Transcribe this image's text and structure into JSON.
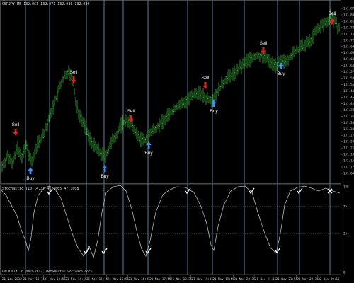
{
  "window": {
    "main_header": "GBPJPY,M5  132.061 132.071 132.030 132.030",
    "indicator_header": "Stochastic (10,14,3) 46.1665 47.1008",
    "footer_label": "FXCM MT4, © 2001-2012, MetaQuotes Software Corp."
  },
  "colors": {
    "background": "#000000",
    "candles": "#3fcf3f",
    "vlines": "#6f9fbf",
    "sell_arrow": "#e02020",
    "buy_arrow": "#3f8fe8",
    "stoch_line": "#b8b8b8",
    "level_line": "#9a9a9a",
    "check": "#ffffff"
  },
  "price_axis": [
    "131.870",
    "131.840",
    "131.810",
    "131.780",
    "131.750",
    "131.720",
    "131.690",
    "131.660",
    "131.630",
    "131.600",
    "131.570",
    "131.540",
    "131.510",
    "131.480",
    "131.450",
    "131.420",
    "131.390",
    "131.360",
    "131.330",
    "131.300",
    "131.270",
    "131.240",
    "131.210",
    "131.180",
    "131.150",
    "131.120",
    "131.090"
  ],
  "stoch_axis": [
    "100",
    "75",
    "25",
    "0"
  ],
  "time_axis": [
    "21 Nov 2012",
    "21 Nov 13:15",
    "21 Nov 13:55",
    "21 Nov 14:15",
    "21 Nov 15:15",
    "21 Nov 15:55",
    "21 Nov 16:35",
    "21 Nov 17:55",
    "21 Nov 18:35",
    "21 Nov 19:15",
    "21 Nov 19:55",
    "21 Nov 20:35",
    "21 Nov 21:15",
    "21 Nov 21:55",
    "21 Nov 22:35",
    "22 Nov 00:15"
  ],
  "signals": [
    {
      "type": "sell",
      "label": "Sell"
    },
    {
      "type": "buy",
      "label": "Buy"
    },
    {
      "type": "sell",
      "label": "Sell"
    },
    {
      "type": "buy",
      "label": "Buy"
    },
    {
      "type": "sell",
      "label": "Sell"
    },
    {
      "type": "buy",
      "label": "Buy"
    },
    {
      "type": "sell",
      "label": "Sell"
    },
    {
      "type": "buy",
      "label": "Buy"
    },
    {
      "type": "sell",
      "label": "Sell"
    },
    {
      "type": "buy",
      "label": "Buy"
    },
    {
      "type": "sell",
      "label": "Sell"
    },
    {
      "type": "buy",
      "label": "Buy"
    },
    {
      "type": "sell",
      "label": "Sell"
    }
  ],
  "stoch_markers": [
    "check",
    "check",
    "check",
    "check",
    "check",
    "check",
    "check",
    "check",
    "cross"
  ]
}
